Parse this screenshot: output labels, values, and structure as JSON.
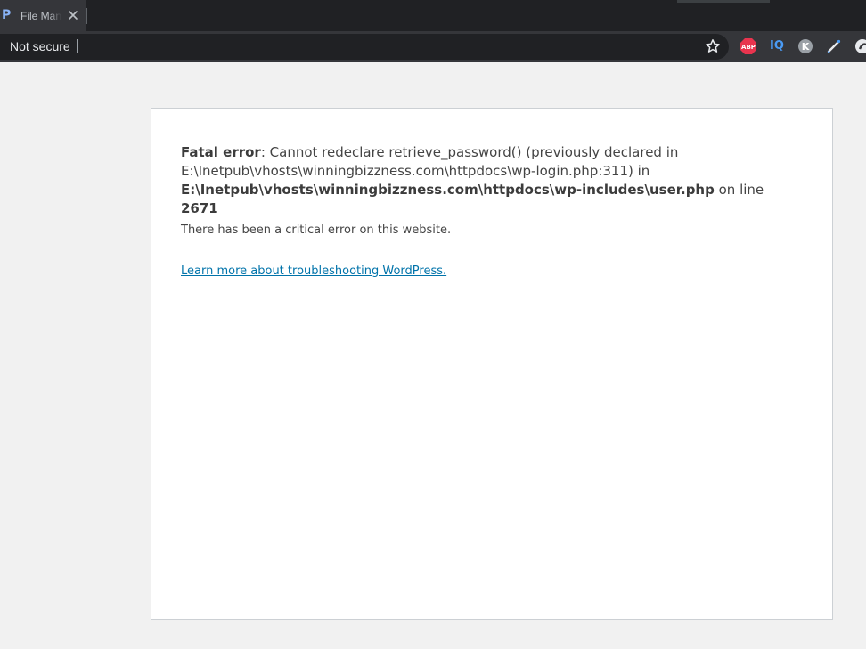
{
  "browser": {
    "tab": {
      "title": "File Manager",
      "favicon": "P"
    },
    "address": {
      "security_label": "Not secure"
    },
    "extensions": {
      "iq": "IQ",
      "abp": "ABP",
      "k": "K"
    }
  },
  "page": {
    "error_heading": "Fatal error",
    "error_text_1": ": Cannot redeclare retrieve_password() (previously declared in",
    "error_text_2": "E:\\Inetpub\\vhosts\\winningbizzness.com\\httpdocs\\wp-login.php:311) in",
    "error_file": "E:\\Inetpub\\vhosts\\winningbizzness.com\\httpdocs\\wp-includes\\user.php",
    "error_on_line": " on line ",
    "error_line": "2671",
    "critical_message": "There has been a critical error on this website.",
    "learn_more_link": "Learn more about troubleshooting WordPress."
  },
  "colors": {
    "link": "#0073aa",
    "text": "#444444",
    "page_bg": "#f1f1f1",
    "chrome_dark": "#202124"
  }
}
